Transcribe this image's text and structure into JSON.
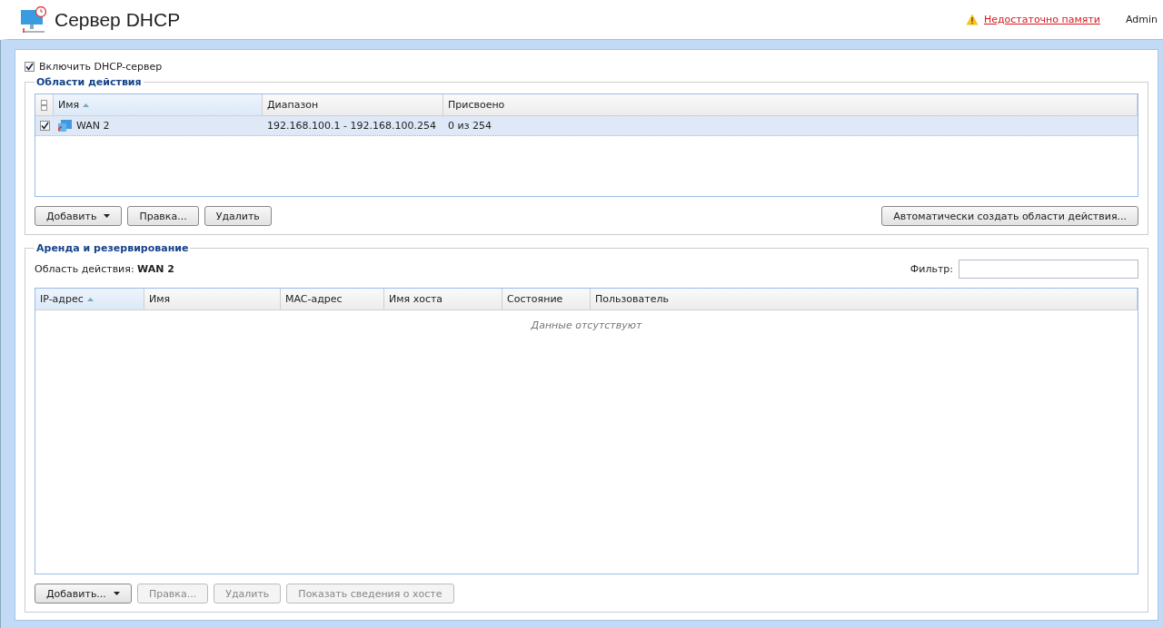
{
  "header": {
    "title": "Сервер DHCP",
    "warning": "Недостаточно памяти",
    "user": "Admin"
  },
  "enable": {
    "label": "Включить DHCP-сервер",
    "checked": true
  },
  "scopes": {
    "legend": "Области действия",
    "columns": [
      {
        "label": "Имя",
        "sorted": true
      },
      {
        "label": "Диапазон",
        "sorted": false
      },
      {
        "label": "Присвоено",
        "sorted": false
      }
    ],
    "rows": [
      {
        "name": "WAN 2",
        "range": "192.168.100.1 - 192.168.100.254",
        "assigned": "0 из 254",
        "checked": true,
        "selected": true
      }
    ],
    "buttons": [
      {
        "label": "Добавить",
        "dropdown": true,
        "disabled": false
      },
      {
        "label": "Правка...",
        "dropdown": false,
        "disabled": false
      },
      {
        "label": "Удалить",
        "dropdown": false,
        "disabled": false
      }
    ],
    "auto_button": "Автоматически создать области действия..."
  },
  "leases": {
    "legend": "Аренда и резервирование",
    "scope_label": "Область действия:",
    "scope_value": "WAN 2",
    "filter_label": "Фильтр:",
    "columns": [
      {
        "label": "IP-адрес",
        "sorted": true
      },
      {
        "label": "Имя",
        "sorted": false
      },
      {
        "label": "MAC-адрес",
        "sorted": false
      },
      {
        "label": "Имя хоста",
        "sorted": false
      },
      {
        "label": "Состояние",
        "sorted": false
      },
      {
        "label": "Пользователь",
        "sorted": false
      }
    ],
    "empty_text": "Данные отсутствуют",
    "buttons": [
      {
        "label": "Добавить...",
        "dropdown": true,
        "disabled": false
      },
      {
        "label": "Правка...",
        "dropdown": false,
        "disabled": true
      },
      {
        "label": "Удалить",
        "dropdown": false,
        "disabled": true
      },
      {
        "label": "Показать сведения о хосте",
        "dropdown": false,
        "disabled": true
      }
    ]
  }
}
